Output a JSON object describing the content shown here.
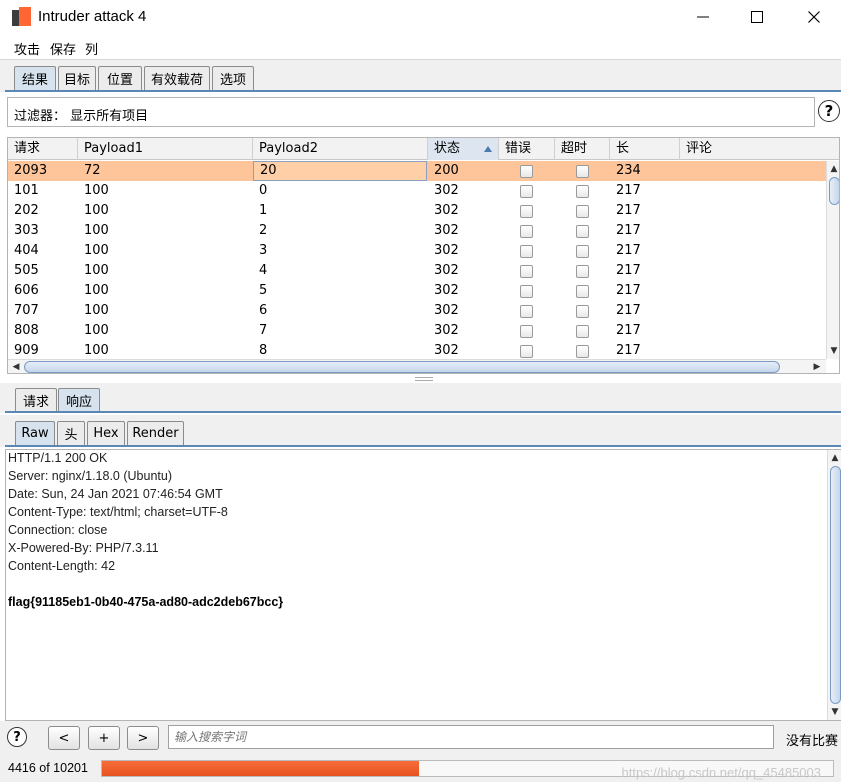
{
  "window": {
    "title": "Intruder attack 4",
    "controls": [
      "minimize",
      "maximize",
      "close"
    ]
  },
  "menu": [
    "攻击",
    "保存",
    "列"
  ],
  "main_tabs": [
    {
      "label": "结果",
      "active": true
    },
    {
      "label": "目标",
      "active": false
    },
    {
      "label": "位置",
      "active": false
    },
    {
      "label": "有效载荷",
      "active": false
    },
    {
      "label": "选项",
      "active": false
    }
  ],
  "filter": {
    "text": "过滤器： 显示所有项目"
  },
  "table": {
    "columns": [
      "请求",
      "Payload1",
      "Payload2",
      "状态",
      "错误",
      "超时",
      "长",
      "评论"
    ],
    "sorted_column": "状态",
    "rows": [
      {
        "request": "2093",
        "payload1": "72",
        "payload2": "20",
        "status": "200",
        "error": false,
        "timeout": false,
        "length": "234",
        "comment": "",
        "selected": true
      },
      {
        "request": "101",
        "payload1": "100",
        "payload2": "0",
        "status": "302",
        "error": false,
        "timeout": false,
        "length": "217",
        "comment": ""
      },
      {
        "request": "202",
        "payload1": "100",
        "payload2": "1",
        "status": "302",
        "error": false,
        "timeout": false,
        "length": "217",
        "comment": ""
      },
      {
        "request": "303",
        "payload1": "100",
        "payload2": "2",
        "status": "302",
        "error": false,
        "timeout": false,
        "length": "217",
        "comment": ""
      },
      {
        "request": "404",
        "payload1": "100",
        "payload2": "3",
        "status": "302",
        "error": false,
        "timeout": false,
        "length": "217",
        "comment": ""
      },
      {
        "request": "505",
        "payload1": "100",
        "payload2": "4",
        "status": "302",
        "error": false,
        "timeout": false,
        "length": "217",
        "comment": ""
      },
      {
        "request": "606",
        "payload1": "100",
        "payload2": "5",
        "status": "302",
        "error": false,
        "timeout": false,
        "length": "217",
        "comment": ""
      },
      {
        "request": "707",
        "payload1": "100",
        "payload2": "6",
        "status": "302",
        "error": false,
        "timeout": false,
        "length": "217",
        "comment": ""
      },
      {
        "request": "808",
        "payload1": "100",
        "payload2": "7",
        "status": "302",
        "error": false,
        "timeout": false,
        "length": "217",
        "comment": ""
      },
      {
        "request": "909",
        "payload1": "100",
        "payload2": "8",
        "status": "302",
        "error": false,
        "timeout": false,
        "length": "217",
        "comment": ""
      }
    ]
  },
  "detail_tabs": [
    {
      "label": "请求",
      "active": false
    },
    {
      "label": "响应",
      "active": true
    }
  ],
  "view_tabs": [
    {
      "label": "Raw",
      "active": true
    },
    {
      "label": "头",
      "active": false
    },
    {
      "label": "Hex",
      "active": false
    },
    {
      "label": "Render",
      "active": false
    }
  ],
  "response_lines": [
    "HTTP/1.1 200 OK",
    "Server: nginx/1.18.0 (Ubuntu)",
    "Date: Sun, 24 Jan 2021 07:46:54 GMT",
    "Content-Type: text/html; charset=UTF-8",
    "Connection: close",
    "X-Powered-By: PHP/7.3.11",
    "Content-Length: 42",
    "",
    "flag{91185eb1-0b40-475a-ad80-adc2deb67bcc}"
  ],
  "search": {
    "help_label": "?",
    "prev_label": "<",
    "add_label": "+",
    "next_label": ">",
    "placeholder": "输入搜索字词",
    "match_text": "没有比赛"
  },
  "status": {
    "count_text": "4416 of 10201",
    "progress_fraction": 0.433,
    "watermark": "https://blog.csdn.net/qq_45485003"
  },
  "colors": {
    "accent": "#5b87b5",
    "selected_row": "#ffc59a",
    "progress": "#f0602a"
  }
}
